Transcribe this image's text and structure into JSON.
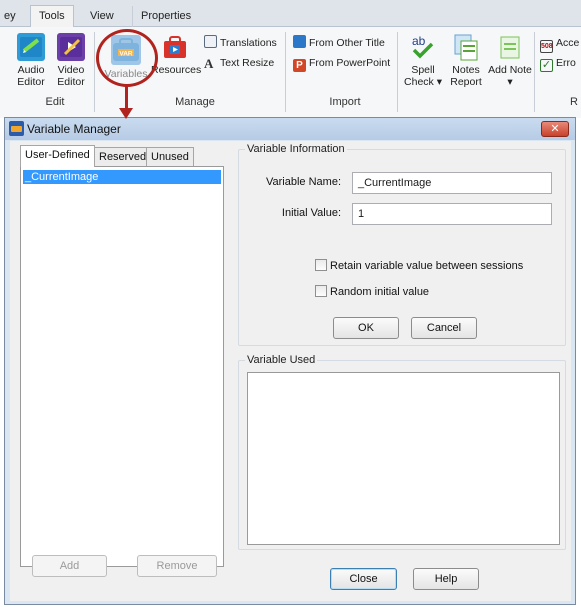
{
  "ribbon": {
    "tabs": [
      "ey",
      "Tools",
      "View",
      "Properties"
    ],
    "active_tab": "Tools",
    "groups": {
      "edit": {
        "label": "Edit",
        "audio": [
          "Audio",
          "Editor"
        ],
        "video": [
          "Video",
          "Editor"
        ]
      },
      "manage": {
        "label": "Manage",
        "variables": "Variables",
        "resources": "Resources",
        "translations": "Translations",
        "text_resize": "Text Resize"
      },
      "import": {
        "label": "Import",
        "from_other_title": "From Other Title",
        "from_powerpoint": "From PowerPoint"
      },
      "review": {
        "label": "R",
        "spell": [
          "Spell",
          "Check ▾"
        ],
        "notes": [
          "Notes",
          "Report"
        ],
        "add_note": [
          "Add Note",
          "▾"
        ],
        "acc": "Acce",
        "err": "Erro"
      }
    }
  },
  "dialog": {
    "title": "Variable Manager",
    "close_glyph": "✕",
    "tabs": [
      "User-Defined",
      "Reserved",
      "Unused"
    ],
    "active_tab": "User-Defined",
    "variables": [
      "_CurrentImage"
    ],
    "add_label": "Add",
    "remove_label": "Remove",
    "info": {
      "legend": "Variable Information",
      "name_label": "Variable Name:",
      "name_value": "_CurrentImage",
      "initial_label": "Initial Value:",
      "initial_value": "1",
      "retain_label": "Retain variable value between sessions",
      "random_label": "Random initial value",
      "ok_label": "OK",
      "cancel_label": "Cancel"
    },
    "used_legend": "Variable Used",
    "close_label": "Close",
    "help_label": "Help"
  },
  "colors": {
    "accent_selection": "#3399ff",
    "callout": "#b0231e"
  }
}
